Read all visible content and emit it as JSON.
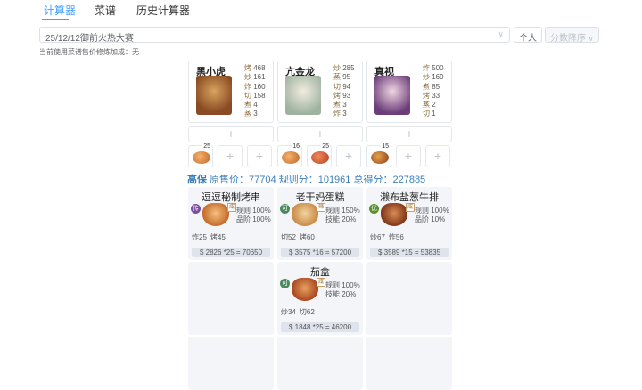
{
  "tabs": [
    "计算器",
    "菜谱",
    "历史计算器"
  ],
  "contest_select": {
    "value": "25/12/12御前火热大赛"
  },
  "buttons": {
    "personal": "个人",
    "sort": "分数降序"
  },
  "hint": "当前使用菜谱售价修炼加成：无",
  "chefs": [
    {
      "name": "黑小虎",
      "stats": [
        [
          "烤",
          "468"
        ],
        [
          "炒",
          "161"
        ],
        [
          "炸",
          "160"
        ],
        [
          "切",
          "158"
        ],
        [
          "煮",
          "4"
        ],
        [
          "蒸",
          "3"
        ]
      ]
    },
    {
      "name": "亢金龙",
      "stats": [
        [
          "炒",
          "285"
        ],
        [
          "蒸",
          "95"
        ],
        [
          "切",
          "94"
        ],
        [
          "烤",
          "93"
        ],
        [
          "煮",
          "3"
        ],
        [
          "炸",
          "3"
        ]
      ]
    },
    {
      "name": "真视",
      "stats": [
        [
          "炸",
          "500"
        ],
        [
          "炒",
          "169"
        ],
        [
          "煮",
          "85"
        ],
        [
          "烤",
          "33"
        ],
        [
          "蒸",
          "2"
        ],
        [
          "切",
          "1"
        ]
      ]
    }
  ],
  "equip_counts": [
    "25",
    "16",
    "25",
    "15"
  ],
  "summary": {
    "label": "高保",
    "text": "原售价：77704 规则分：101961 总得分：227885"
  },
  "dishes": [
    {
      "name": "逗逗秘制烤串",
      "rarity": "传",
      "cond": "咸",
      "rules": [
        "规则 100%",
        "品阶 100%"
      ],
      "skills": [
        "炸25",
        "烤45"
      ],
      "price": "$ 2826 *25 = 70650"
    },
    {
      "name": "老干妈蛋糕",
      "rarity": "可",
      "cond": "辣",
      "rules": [
        "规则 150%",
        "技能 20%"
      ],
      "skills": [
        "切52",
        "烤60"
      ],
      "price": "$ 3575 *16 = 57200"
    },
    {
      "name": "濑布盐葱牛排",
      "rarity": "优",
      "cond": "咸",
      "rules": [
        "规则 100%",
        "品阶 10%"
      ],
      "skills": [
        "炒67",
        "炸56"
      ],
      "price": "$ 3589 *15 = 53835"
    },
    {
      "name": "茄盒",
      "rarity": "可",
      "cond": "咸",
      "rules": [
        "规则 100%",
        "技能 20%"
      ],
      "skills": [
        "炒34",
        "切62"
      ],
      "price": "$ 1848 *25 = 46200"
    }
  ],
  "colors": {
    "accent": "#409eff",
    "rarity_chuan": "#7b4fa0",
    "rarity_ke": "#4a8a5c",
    "rarity_you": "#5a8f2e"
  }
}
